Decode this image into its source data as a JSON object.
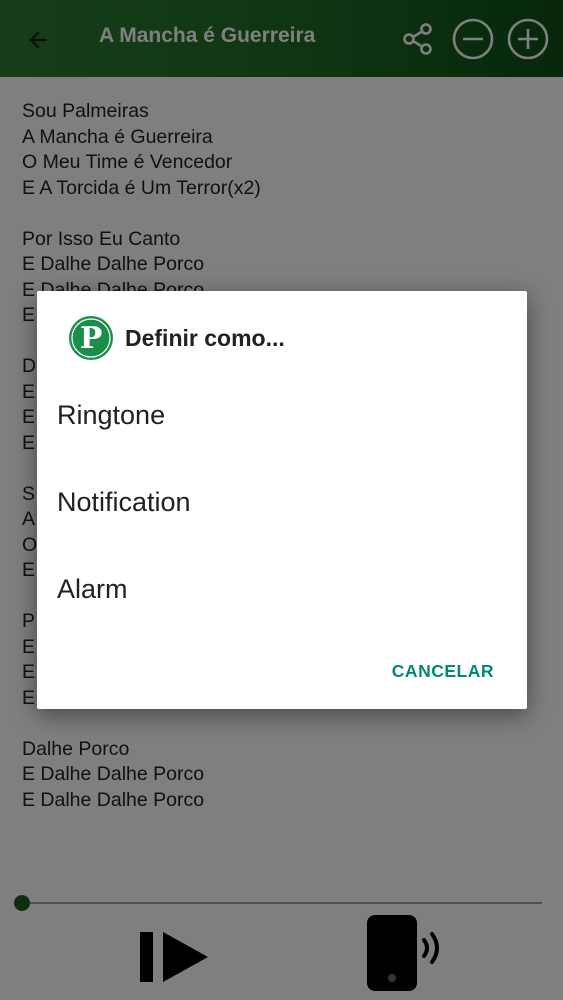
{
  "app_bar": {
    "title": "A Mancha é Guerreira",
    "back_icon": "arrow-back-icon",
    "actions": [
      "share-icon",
      "zoom-out-icon",
      "zoom-in-icon"
    ],
    "colors": {
      "start": "#2e7d32",
      "end": "#0d4f16"
    }
  },
  "lyrics": {
    "stanzas": [
      [
        "Sou Palmeiras",
        "A Mancha é Guerreira",
        "O Meu Time é Vencedor",
        "E A Torcida é Um Terror(x2)"
      ],
      [
        "Por Isso Eu Canto",
        "E Dalhe Dalhe Porco",
        "E Dalhe Dalhe Porco",
        "E"
      ],
      [
        "D",
        "E",
        "E",
        "E"
      ],
      [
        "S",
        "A",
        "O",
        "E"
      ],
      [
        "P",
        "E",
        "E",
        "E"
      ],
      [
        "Dalhe Porco",
        "E Dalhe Dalhe Porco",
        "E Dalhe Dalhe Porco"
      ]
    ]
  },
  "player": {
    "progress": 0,
    "play_icon": "play-pause-icon",
    "ringtone_icon": "phone-ringing-icon",
    "accent": "#1b5e20"
  },
  "dialog": {
    "logo_icon": "palmeiras-p-logo",
    "logo_letter": "P",
    "title": "Definir como...",
    "options": [
      "Ringtone",
      "Notification",
      "Alarm"
    ],
    "cancel_label": "CANCELAR",
    "accent": "#00897b"
  }
}
